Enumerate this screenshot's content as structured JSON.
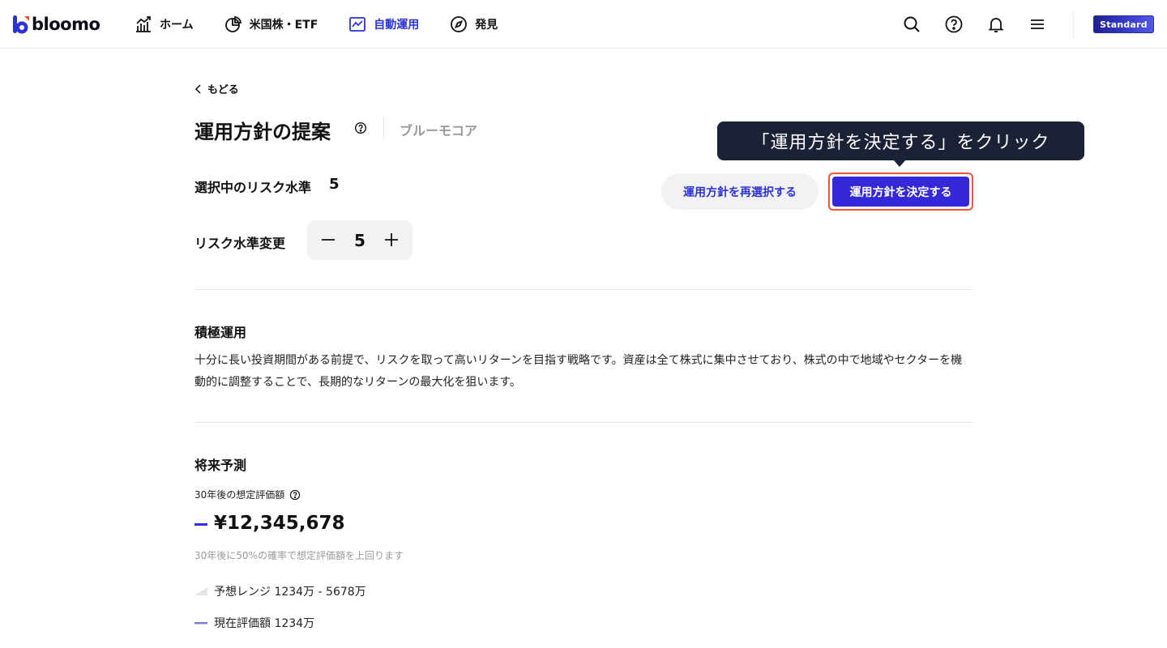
{
  "app": {
    "logo_text": "bloomo",
    "plan_badge": "Standard",
    "brand_color": "#2b33d6",
    "accent_color": "#3428d8"
  },
  "nav": {
    "items": [
      {
        "label": "ホーム",
        "icon": "chart-up-icon"
      },
      {
        "label": "米国株・ETF",
        "icon": "pie-chart-icon"
      },
      {
        "label": "自動運用",
        "icon": "line-chart-icon",
        "active": true
      },
      {
        "label": "発見",
        "icon": "compass-icon"
      }
    ],
    "right_icons": [
      "search-icon",
      "help-icon",
      "bell-icon",
      "menu-icon"
    ]
  },
  "page": {
    "back_label": "もどる",
    "title": "運用方針の提案",
    "subtitle": "ブルーモコア",
    "risk_label": "選択中のリスク水準",
    "risk_value": "5",
    "change_label": "リスク水準変更",
    "stepper_value": "5",
    "reselect_button": "運用方針を再選択する",
    "decide_button": "運用方針を決定する",
    "tooltip": "「運用方針を決定する」をクリック"
  },
  "strategy": {
    "title": "積極運用",
    "description": "十分に長い投資期間がある前提で、リスクを取って高いリターンを目指す戦略です。資産は全て株式に集中させており、株式の中で地域やセクターを機動的に調整することで、長期的なリターンの最大化を狙います。"
  },
  "forecast": {
    "title": "将来予測",
    "label": "30年後の想定評価額",
    "amount": "¥12,345,678",
    "probability": "30年後に50%の確率で想定評価額を上回ります",
    "legend_range": "予想レンジ 1234万 - 5678万",
    "legend_current": "現在評価額 1234万"
  }
}
